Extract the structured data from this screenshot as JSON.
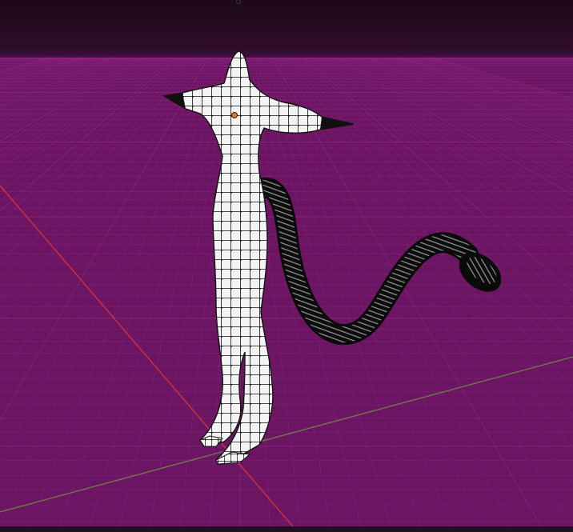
{
  "viewport": {
    "name": "3D Viewport",
    "background_top": "#1f0a1c",
    "background_horizon": "#3d0f38",
    "floor_color": "#6b1563",
    "grid_line_color": "#9a2b8d",
    "grid_major_color": "#b0409f",
    "x_axis_color": "#d0323a",
    "y_axis_color": "#6f7a4a"
  },
  "model": {
    "name": "character-mesh",
    "shading": "wireframe-over-solid",
    "mesh_color": "#f2f2f2",
    "wire_color": "#111111",
    "tail_color": "#1a1a1a",
    "origin_color": "#e07a1a"
  }
}
